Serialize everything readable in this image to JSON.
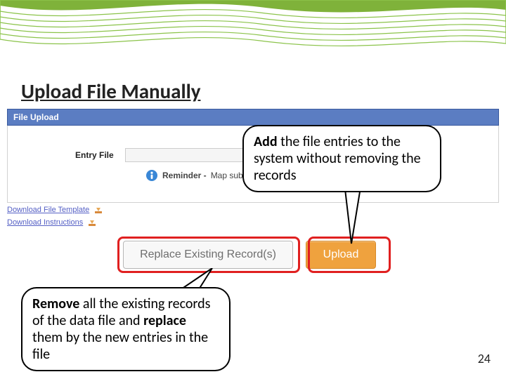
{
  "slide": {
    "title": "Upload File Manually",
    "page_number": "24"
  },
  "panel": {
    "title": "File Upload",
    "entry_label": "Entry File",
    "browse_label": "...",
    "reminder_prefix": "Reminder - ",
    "reminder_text": "Map sub"
  },
  "links": {
    "template": "Download File Template",
    "instructions": "Download Instructions"
  },
  "buttons": {
    "replace": "Replace Existing Record(s)",
    "upload": "Upload"
  },
  "callouts": {
    "add_bold": "Add",
    "add_rest": " the file entries to the system without removing the records",
    "remove_b1": "Remove",
    "remove_mid": " all the existing records of the data file and ",
    "remove_b2": "replace",
    "remove_end": " them by the new entries in the file"
  }
}
